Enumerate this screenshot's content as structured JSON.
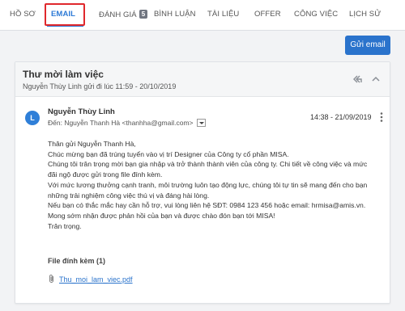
{
  "tabs": [
    {
      "label": "HỒ SƠ"
    },
    {
      "label": "EMAIL"
    },
    {
      "label": "ĐÁNH GIÁ",
      "badge": "5"
    },
    {
      "label": "BÌNH LUẬN"
    },
    {
      "label": "TÀI LIỆU"
    },
    {
      "label": "OFFER"
    },
    {
      "label": "CÔNG VIỆC"
    },
    {
      "label": "LỊCH SỬ"
    }
  ],
  "active_tab": "EMAIL",
  "toolbar": {
    "send_label": "Gửi email"
  },
  "thread": {
    "title": "Thư mời làm việc",
    "subtitle": "Nguyễn Thùy Linh gửi đi lúc 11:59 - 20/10/2019"
  },
  "message": {
    "avatar_initial": "L",
    "sender": "Nguyễn Thùy Linh",
    "to": "Đến: Nguyễn Thanh Hà <thanhha@gmail.com>",
    "time": "14:38 - 21/09/2019",
    "body": [
      "Thân gửi Nguyễn Thanh Hà,",
      "Chúc mừng bạn đã trúng tuyển vào vị trí Designer của Công ty cổ phần MISA.",
      "Chúng tôi trân trọng mời bạn gia nhập và trở thành thành viên của công ty. Chi tiết về công việc và mức",
      "đãi ngộ được gửi trong file đính kèm.",
      "Với mức lương thưởng cạnh tranh, môi trường luôn tạo động lực, chúng tôi tự tin sẽ mang đến cho bạn",
      "những trải nghiệm công việc thú vị và đáng hài lòng.",
      "Nếu bạn có thắc mắc hay cần hỗ trợ, vui lòng liên hệ SĐT: 0984 123 456 hoặc email: hrmisa@amis.vn.",
      "Mong sớm nhận được phản hồi của bạn và được chào đón bạn tới MISA!",
      "Trân trọng."
    ],
    "attachments_label": "File đính kèm (1)",
    "attachment_name": "Thu_moi_lam_viec.pdf"
  },
  "icons": {
    "reply": "reply-all-icon",
    "collapse": "chevron-up-icon",
    "menu": "more-vertical-icon",
    "attachment": "paperclip-icon",
    "dropdown": "caret-down-icon"
  },
  "colors": {
    "accent": "#2d7ad6",
    "button": "#2a73cc",
    "highlight": "#e0282c",
    "avatar": "#2f7fd8",
    "badge": "#707580"
  }
}
